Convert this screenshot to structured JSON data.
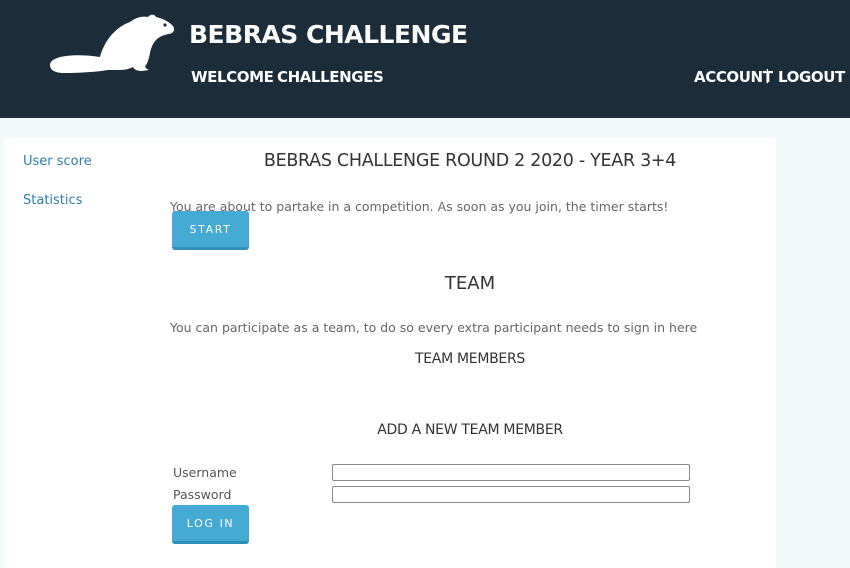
{
  "header": {
    "site_title": "BEBRAS CHALLENGE",
    "logo_icon": "beaver-logo-icon",
    "nav": {
      "welcome": "WELCOME",
      "challenges": "CHALLENGES",
      "account": "ACCOUNT",
      "separator": "|",
      "logout": "LOGOUT"
    }
  },
  "sidebar": {
    "items": [
      {
        "label": "User score"
      },
      {
        "label": "Statistics"
      }
    ]
  },
  "main": {
    "title": "BEBRAS CHALLENGE ROUND 2 2020 - YEAR 3+4",
    "intro_text": "You are about to partake in a competition. As soon as you join, the timer starts!",
    "start_button": "START",
    "team_heading": "TEAM",
    "team_text": "You can participate as a team, to do so every extra participant needs to sign in here",
    "team_members_heading": "TEAM MEMBERS",
    "add_member_heading": "ADD A NEW TEAM MEMBER",
    "form": {
      "username_label": "Username",
      "username_value": "",
      "password_label": "Password",
      "password_value": "",
      "login_button": "LOG IN"
    }
  },
  "colors": {
    "header_bg": "#1b2d3a",
    "accent": "#45aad3",
    "link": "#2f7fa6",
    "page_bg": "#f2f9fa"
  }
}
